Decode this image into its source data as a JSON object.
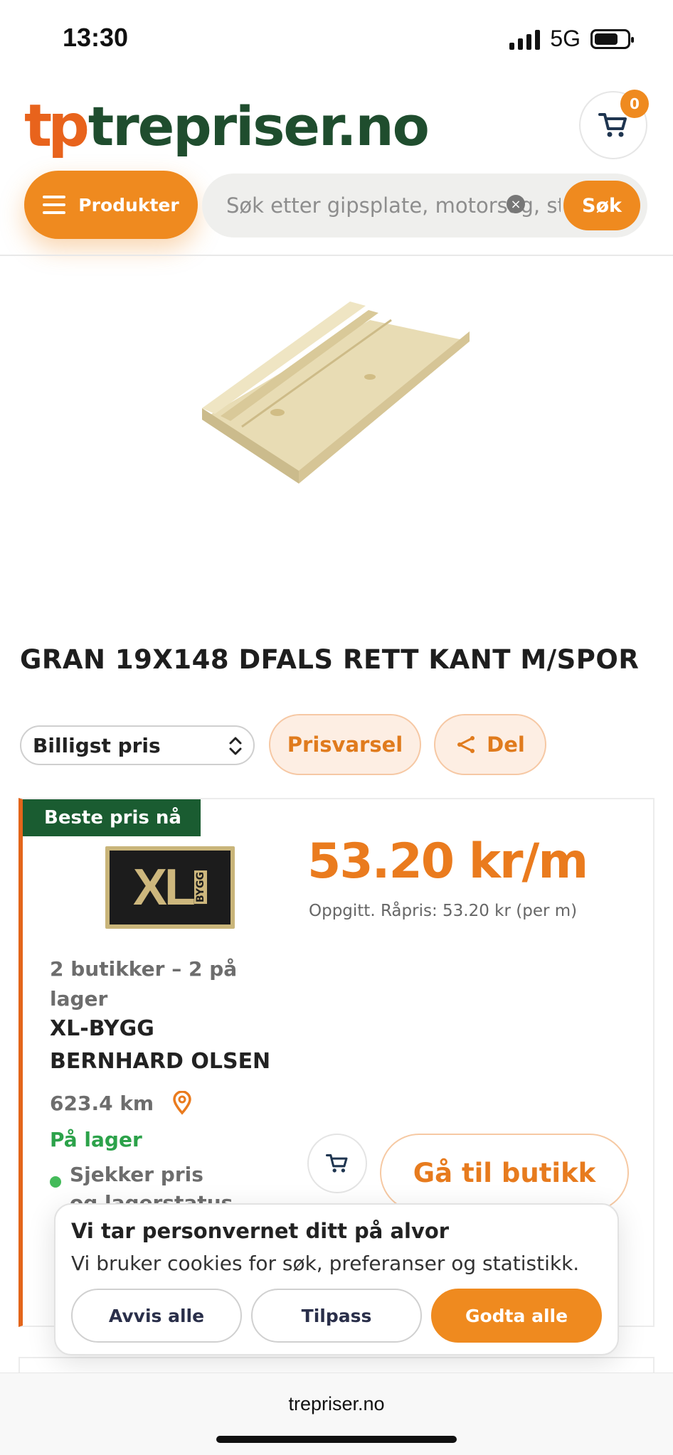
{
  "status_bar": {
    "time": "13:30",
    "network": "5G"
  },
  "header": {
    "logo_mark": "tp",
    "logo_text": "trepriser.no",
    "cart_count": "0",
    "products_label": "Produkter",
    "search_placeholder": "Søk etter gipsplate, motorsag, st",
    "search_button": "Søk"
  },
  "product": {
    "title": "GRAN 19X148 DFALS RETT KANT M/SPOR"
  },
  "controls": {
    "sort_value": "Billigst pris",
    "price_alert": "Prisvarsel",
    "share": "Del"
  },
  "offer": {
    "badge": "Beste pris nå",
    "store_logo_text": "XL",
    "store_logo_sub": "BYGG",
    "price": "53.20 kr/m",
    "raw_price": "Oppgitt. Råpris: 53.20 kr (per m)",
    "stores_count": "2 butikker – 2 på lager",
    "store_name": "XL-BYGG BERNHARD OLSEN",
    "distance": "623.4 km",
    "stock": "På lager",
    "check_status": "Sjekker pris og lagerstatus",
    "goto_store": "Gå til butikk"
  },
  "cookie": {
    "title": "Vi tar personvernet ditt på alvor",
    "text": "Vi bruker cookies for søk, preferanser og statistikk.",
    "reject": "Avvis alle",
    "customize": "Tilpass",
    "accept": "Godta alle"
  },
  "browser": {
    "url": "trepriser.no"
  },
  "colors": {
    "accent": "#ef8a1f",
    "brand_green": "#1f4d2e",
    "badge_green": "#1a5c31",
    "stock_green": "#2ca24a"
  },
  "icons": [
    "menu-icon",
    "cart-icon",
    "clear-icon",
    "chevron-updown-icon",
    "share-icon",
    "location-pin-icon"
  ]
}
